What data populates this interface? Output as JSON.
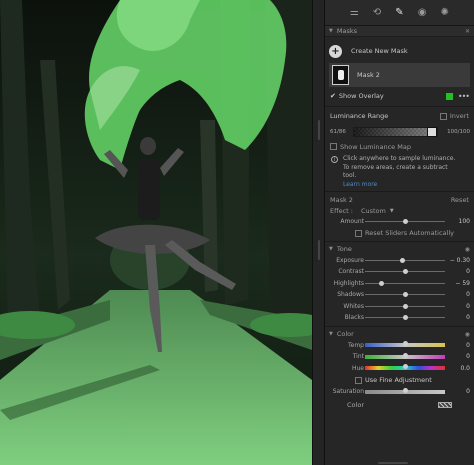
{
  "toolbar": {
    "icons": [
      "sliders-icon",
      "crop-rotate-icon",
      "brush-icon",
      "eye-icon",
      "mask-circle-icon"
    ]
  },
  "masks": {
    "header": "Masks",
    "create_label": "Create New Mask",
    "mask_name": "Mask 2",
    "show_overlay": "Show Overlay",
    "overlay_color": "#22c020"
  },
  "luminance": {
    "title": "Luminance Range",
    "invert": "Invert",
    "left_value": "61/86",
    "right_value": "100/100",
    "show_map": "Show Luminance Map",
    "info": "Click anywhere to sample luminance. To remove areas, create a subtract tool.",
    "learn_more": "Learn more"
  },
  "mask2": {
    "title": "Mask 2",
    "reset": "Reset",
    "effect_label": "Effect :",
    "effect_value": "Custom",
    "amount_label": "Amount",
    "amount_value": "100",
    "amount_pos": 0.5,
    "reset_auto": "Reset Sliders Automatically"
  },
  "tone": {
    "title": "Tone",
    "sliders": [
      {
        "label": "Exposure",
        "value": "− 0.30",
        "pos": 0.47
      },
      {
        "label": "Contrast",
        "value": "0",
        "pos": 0.5
      },
      {
        "label": "Highlights",
        "value": "− 59",
        "pos": 0.21
      },
      {
        "label": "Shadows",
        "value": "0",
        "pos": 0.5
      },
      {
        "label": "Whites",
        "value": "0",
        "pos": 0.5
      },
      {
        "label": "Blacks",
        "value": "0",
        "pos": 0.5
      }
    ]
  },
  "color": {
    "title": "Color",
    "sliders": [
      {
        "label": "Temp",
        "value": "0",
        "pos": 0.5,
        "grad": "temp"
      },
      {
        "label": "Tint",
        "value": "0",
        "pos": 0.5,
        "grad": "tint"
      },
      {
        "label": "Hue",
        "value": "0.0",
        "pos": 0.5,
        "grad": "hue"
      }
    ],
    "fine_adjust": "Use Fine Adjustment",
    "saturation": {
      "label": "Saturation",
      "value": "0",
      "pos": 0.5
    },
    "color_label": "Color"
  }
}
